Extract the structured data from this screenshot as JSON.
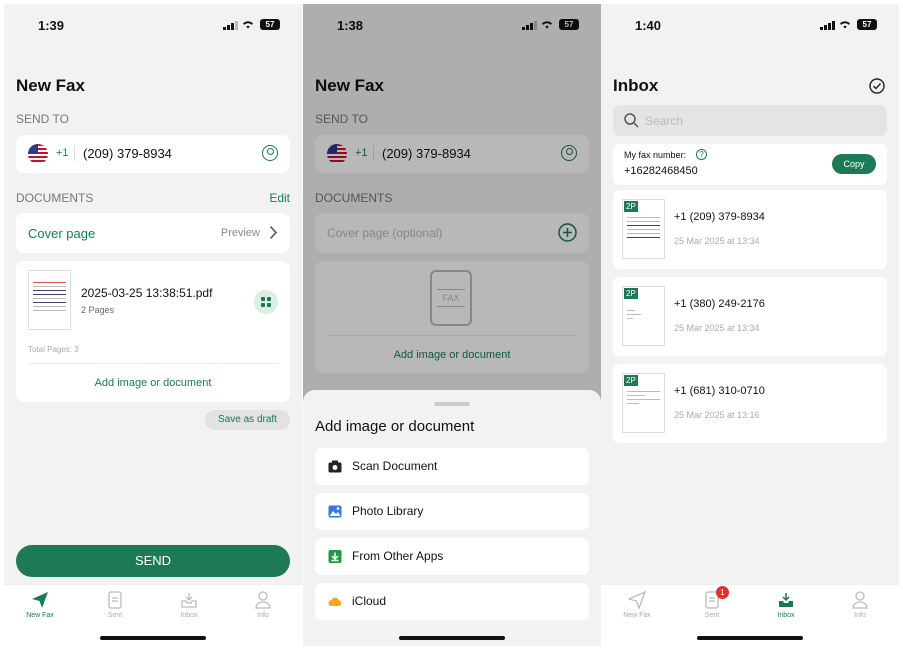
{
  "colors": {
    "accent": "#1e7a55",
    "background": "#f2f2f2",
    "danger": "#e0302f"
  },
  "screen1": {
    "time": "1:39",
    "battery": "57",
    "title": "New Fax",
    "send_to_label": "SEND TO",
    "country_code": "+1",
    "phone_number": "(209) 379-8934",
    "documents_label": "DOCUMENTS",
    "edit_label": "Edit",
    "cover_page_label": "Cover page",
    "preview_label": "Preview",
    "file_name": "2025-03-25 13:38:51.pdf",
    "file_pages": "2 Pages",
    "total_pages": "Total Pages: 3",
    "add_doc_label": "Add image or document",
    "save_draft_label": "Save as draft",
    "send_label": "SEND"
  },
  "screen2": {
    "time": "1:38",
    "battery": "57",
    "title": "New Fax",
    "send_to_label": "SEND TO",
    "country_code": "+1",
    "phone_number": "(209) 379-8934",
    "documents_label": "DOCUMENTS",
    "cover_placeholder": "Cover page (optional)",
    "fax_icon_label": "FAX",
    "add_doc_label": "Add image or document",
    "sheet_title": "Add image or document",
    "sheet_items": [
      {
        "label": "Scan Document",
        "icon": "camera-icon"
      },
      {
        "label": "Photo Library",
        "icon": "photo-icon"
      },
      {
        "label": "From Other Apps",
        "icon": "download-icon"
      },
      {
        "label": "iCloud",
        "icon": "cloud-icon"
      }
    ]
  },
  "screen3": {
    "time": "1:40",
    "battery": "57",
    "title": "Inbox",
    "search_placeholder": "Search",
    "my_fax_label": "My fax number:",
    "my_fax_number": "+16282468450",
    "copy_label": "Copy",
    "items": [
      {
        "pages": "2P",
        "number": "+1 (209) 379-8934",
        "date": "25 Mar 2025 at 13:34"
      },
      {
        "pages": "2P",
        "number": "+1 (380) 249-2176",
        "date": "25 Mar 2025 at 13:34"
      },
      {
        "pages": "2P",
        "number": "+1 (681) 310-0710",
        "date": "25 Mar 2025 at 13:16"
      }
    ],
    "sent_badge": "1"
  },
  "tabs": [
    {
      "label": "New Fax",
      "icon": "paper-plane-icon"
    },
    {
      "label": "Sent",
      "icon": "document-icon"
    },
    {
      "label": "Inbox",
      "icon": "inbox-icon"
    },
    {
      "label": "Info",
      "icon": "person-icon"
    }
  ]
}
